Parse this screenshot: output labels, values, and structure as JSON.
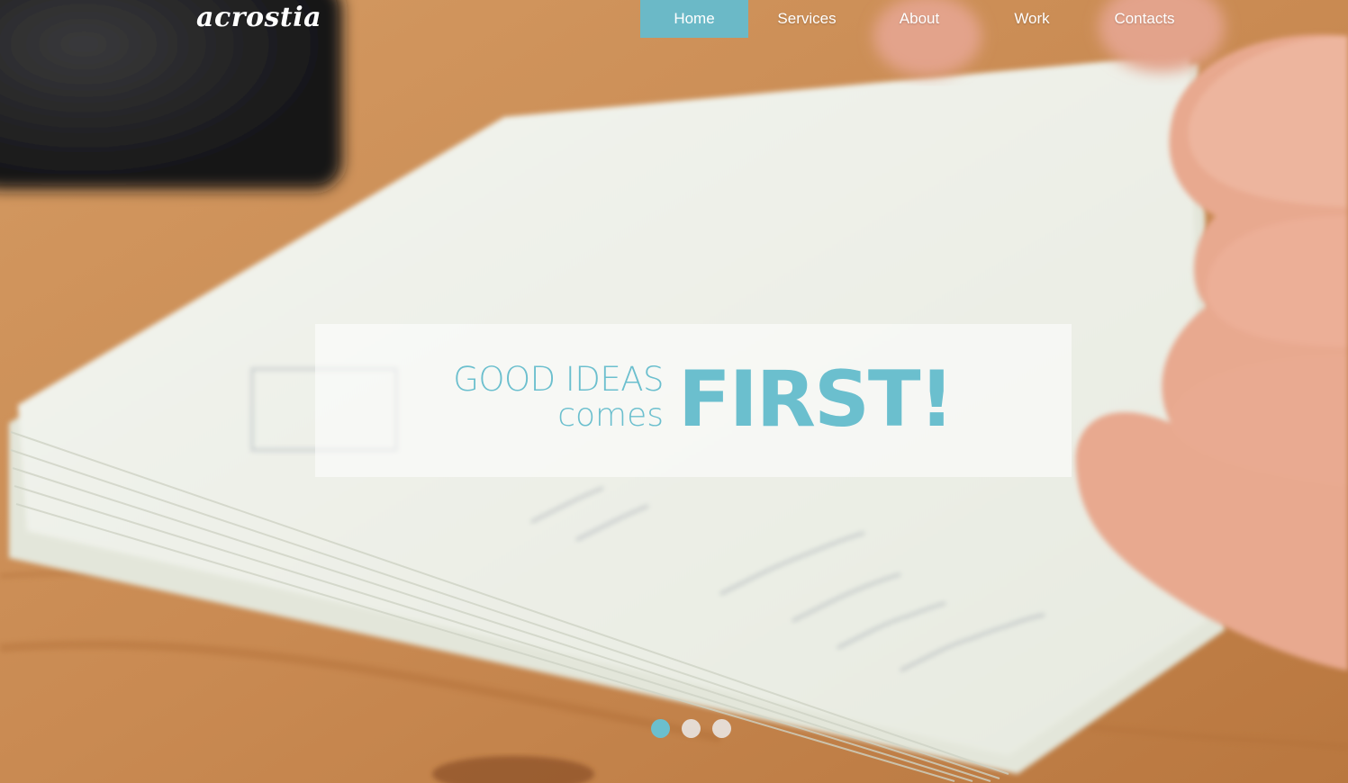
{
  "header": {
    "logo_text": "acrostia",
    "nav": [
      {
        "label": "Home",
        "active": true
      },
      {
        "label": "Services",
        "active": false
      },
      {
        "label": "About",
        "active": false
      },
      {
        "label": "Work",
        "active": false
      },
      {
        "label": "Contacts",
        "active": false
      }
    ]
  },
  "hero": {
    "line1": "GOOD IDEAS",
    "line2": "comes",
    "big": "FIRST!",
    "slides_count": 3,
    "active_slide": 1
  },
  "colors": {
    "accent": "#6bbfce",
    "nav_active_bg": "#6bb9c7",
    "wood": "#c98a52",
    "paper": "#eef0e8"
  }
}
